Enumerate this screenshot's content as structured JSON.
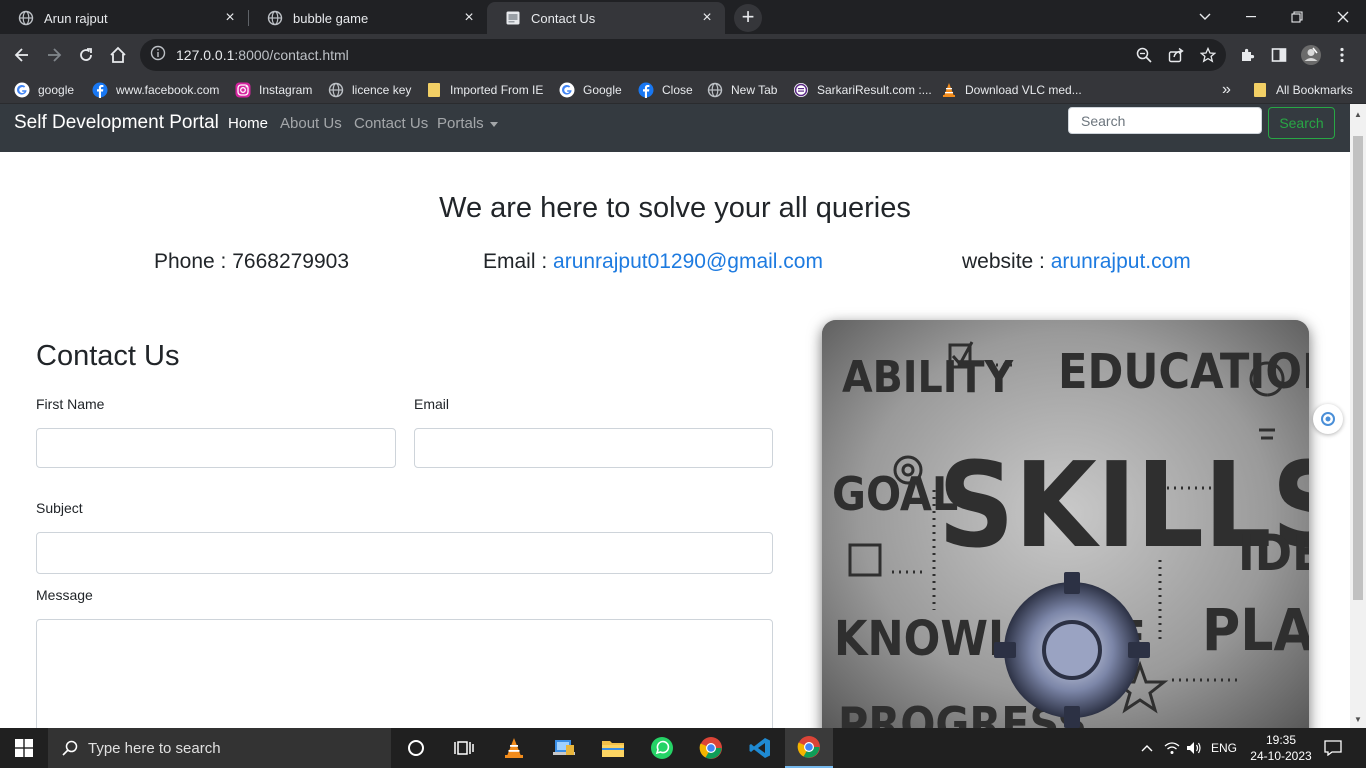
{
  "browser": {
    "tabs": [
      {
        "title": "Arun rajput"
      },
      {
        "title": "bubble game"
      },
      {
        "title": "Contact Us"
      }
    ],
    "url_host": "127.0.0.1",
    "url_rest": ":8000/contact.html",
    "bookmarks": [
      {
        "label": "google"
      },
      {
        "label": "www.facebook.com"
      },
      {
        "label": "Instagram"
      },
      {
        "label": "licence key"
      },
      {
        "label": "Imported From IE"
      },
      {
        "label": "Google"
      },
      {
        "label": "Close"
      },
      {
        "label": "New Tab"
      },
      {
        "label": "SarkariResult.com :..."
      },
      {
        "label": "Download VLC med..."
      }
    ],
    "overflow": "»",
    "all_bookmarks": "All Bookmarks"
  },
  "site": {
    "brand": "Self Development Portal",
    "nav": [
      "Home",
      "About Us",
      "Contact Us",
      "Portals"
    ],
    "search_placeholder": "Search",
    "search_button": "Search"
  },
  "hero": {
    "title": "We are here to solve your all queries",
    "phone_label": "Phone : ",
    "phone": "7668279903",
    "email_label": "Email : ",
    "email": "arunrajput01290@gmail.com",
    "website_label": "website : ",
    "website": "arunrajput.com"
  },
  "form": {
    "title": "Contact Us",
    "first_name_label": "First Name",
    "email_label": "Email",
    "subject_label": "Subject",
    "message_label": "Message"
  },
  "image": {
    "words": [
      "ABILITY",
      "EDUCATION",
      "GOAL",
      "SKILLS",
      "IDEA",
      "KNOWLEDGE",
      "PLAN",
      "PROGRESS"
    ]
  },
  "taskbar": {
    "search_placeholder": "Type here to search",
    "lang": "ENG",
    "time": "19:35",
    "date": "24-10-2023"
  },
  "colors": {
    "link": "#1e7be0",
    "navbar": "#343a40",
    "success": "#28a745"
  }
}
